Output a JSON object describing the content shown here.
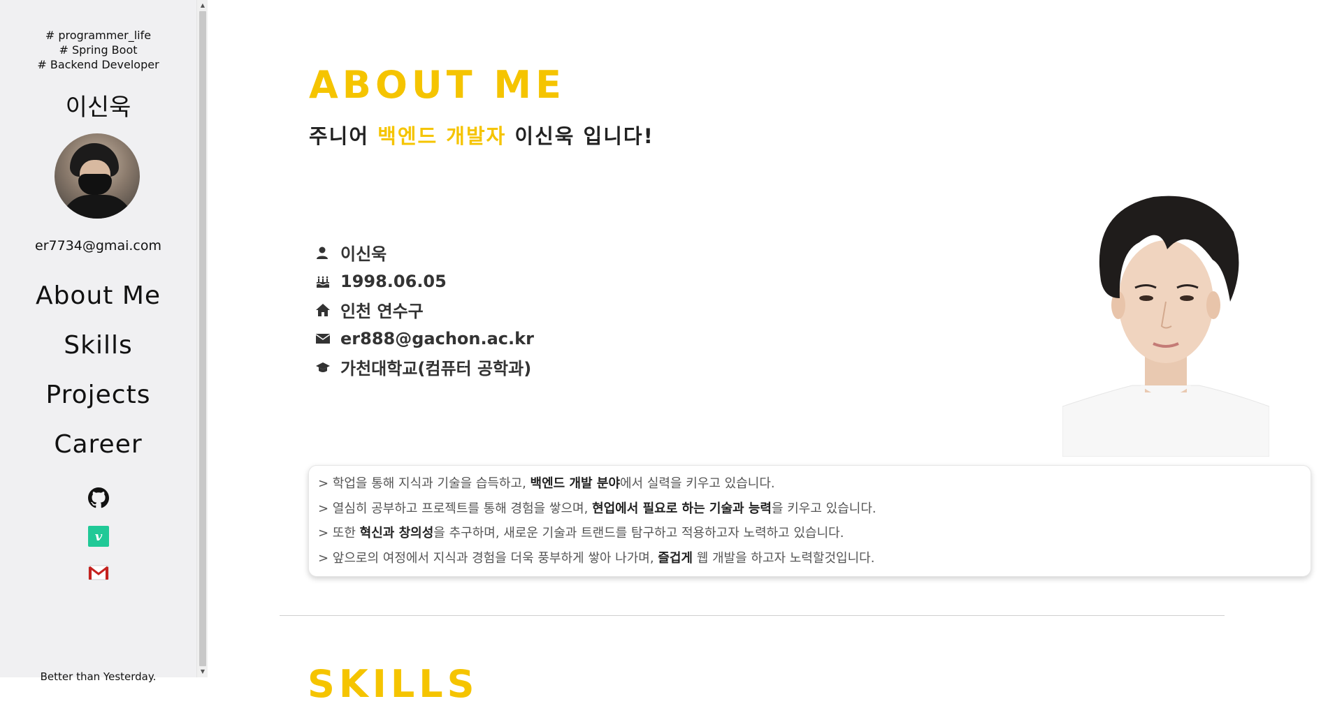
{
  "sidebar": {
    "hashtags": [
      "# programmer_life",
      "# Spring Boot",
      "# Backend Developer"
    ],
    "name": "이신욱",
    "email": "er7734@gmai.com",
    "nav": [
      "About Me",
      "Skills",
      "Projects",
      "Career"
    ],
    "social_icons": [
      "github-icon",
      "velog-icon",
      "gmail-icon"
    ],
    "velog_letter": "v",
    "tagline": "Better than Yesterday."
  },
  "about": {
    "title": "ABOUT ME",
    "subtitle_parts": [
      "주니어 ",
      "백엔드 개발자",
      " 이신욱 입니다!"
    ],
    "info": [
      {
        "icon": "user-icon",
        "text": "이신욱"
      },
      {
        "icon": "birthday-cake-icon",
        "text": "1998.06.05"
      },
      {
        "icon": "home-icon",
        "text": "인천 연수구"
      },
      {
        "icon": "envelope-icon",
        "text": "er888@gachon.ac.kr"
      },
      {
        "icon": "graduation-cap-icon",
        "text": "가천대학교(컴퓨터 공학과)"
      }
    ],
    "quotes": [
      {
        "before": "> 학업을 통해 지식과 기술을 습득하고, ",
        "bold": "백엔드 개발 분야",
        "after": "에서 실력을 키우고 있습니다."
      },
      {
        "before": "> 열심히 공부하고 프로젝트를 통해 경험을 쌓으며, ",
        "bold": "현업에서 필요로 하는 기술과 능력",
        "after": "을 키우고 있습니다."
      },
      {
        "before": "> 또한 ",
        "bold": "혁신과 창의성",
        "after": "을 추구하며, 새로운 기술과 트랜드를 탐구하고 적용하고자 노력하고 있습니다."
      },
      {
        "before": "> 앞으로의 여정에서 지식과 경험을 더욱 풍부하게 쌓아 나가며, ",
        "bold": "즐겁게",
        "after": " 웹 개발을 하고자 노력할것입니다."
      }
    ]
  },
  "skills": {
    "title": "SKILLS"
  },
  "colors": {
    "accent": "#f5c400",
    "sidebar_bg": "#f0f0f2"
  }
}
